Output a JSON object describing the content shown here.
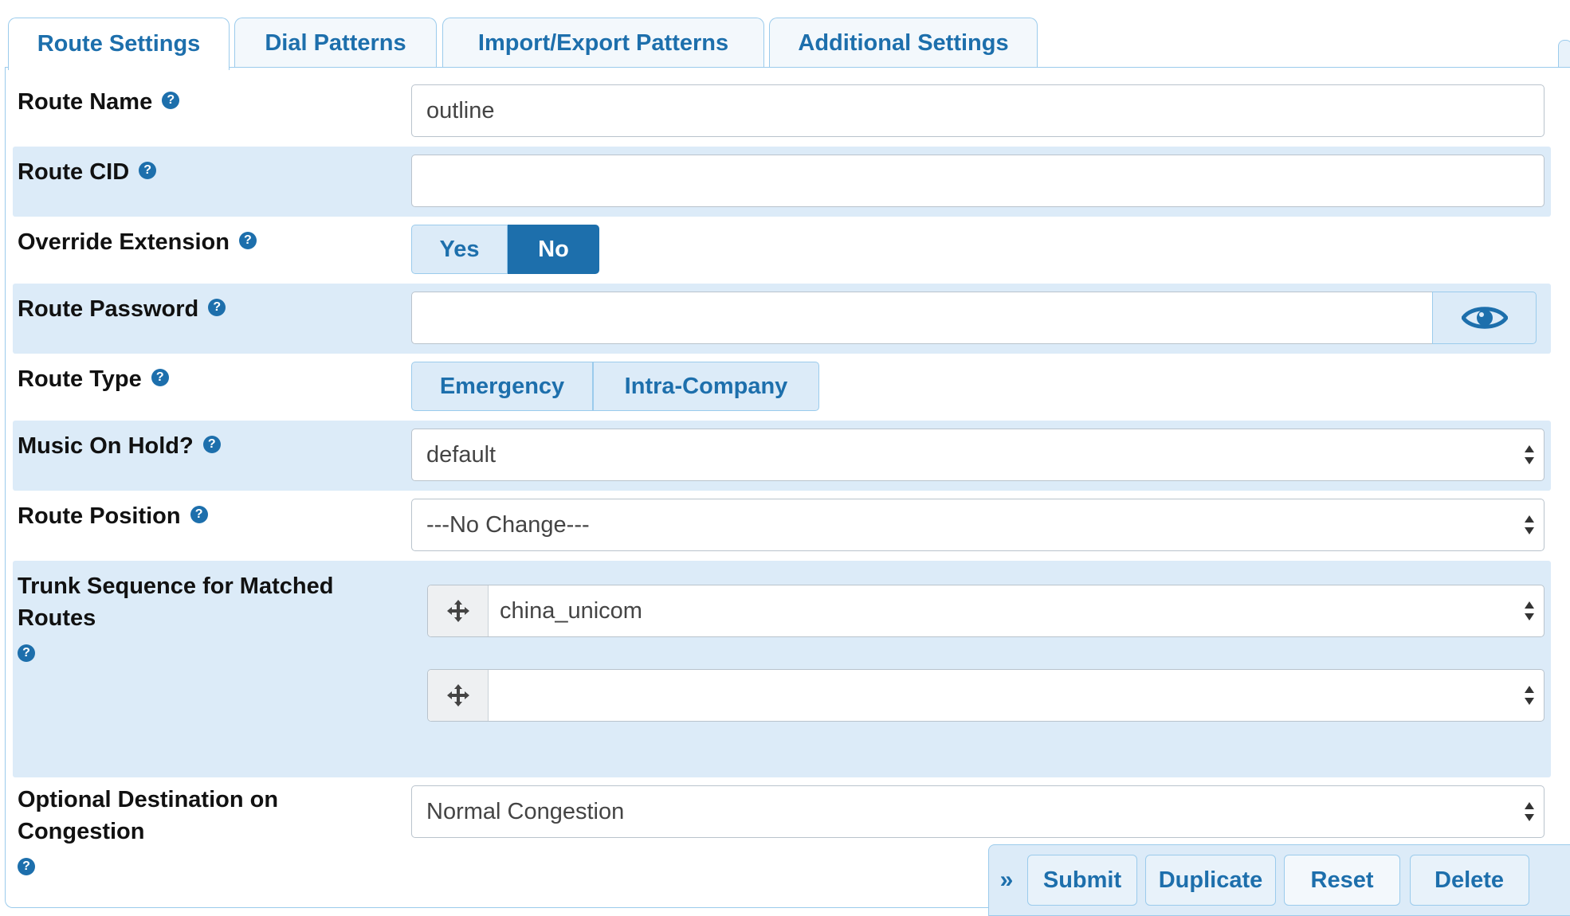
{
  "tabs": [
    {
      "label": "Route Settings",
      "active": true
    },
    {
      "label": "Dial Patterns",
      "active": false
    },
    {
      "label": "Import/Export Patterns",
      "active": false
    },
    {
      "label": "Additional Settings",
      "active": false
    }
  ],
  "help_glyph": "?",
  "form": {
    "route_name": {
      "label": "Route Name",
      "value": "outline"
    },
    "route_cid": {
      "label": "Route CID",
      "value": ""
    },
    "override_extension": {
      "label": "Override Extension",
      "options": [
        "Yes",
        "No"
      ],
      "selected": "No"
    },
    "route_password": {
      "label": "Route Password",
      "value": "",
      "toggle_icon": "eye-icon"
    },
    "route_type": {
      "label": "Route Type",
      "options": [
        "Emergency",
        "Intra-Company"
      ]
    },
    "music_on_hold": {
      "label": "Music On Hold?",
      "value": "default"
    },
    "route_position": {
      "label": "Route Position",
      "value": "---No Change---"
    },
    "trunk_sequence": {
      "label_line1": "Trunk Sequence for Matched",
      "label_line2": "Routes",
      "trunks": [
        "china_unicom",
        ""
      ]
    },
    "optional_destination": {
      "label_line1": "Optional Destination on",
      "label_line2": "Congestion",
      "value": "Normal Congestion"
    }
  },
  "actions": {
    "expand_glyph": "»",
    "submit": "Submit",
    "duplicate": "Duplicate",
    "reset": "Reset",
    "delete": "Delete"
  },
  "colors": {
    "accent": "#1d6fac",
    "row_shade": "#dcebf8",
    "border": "#9bcbec"
  }
}
